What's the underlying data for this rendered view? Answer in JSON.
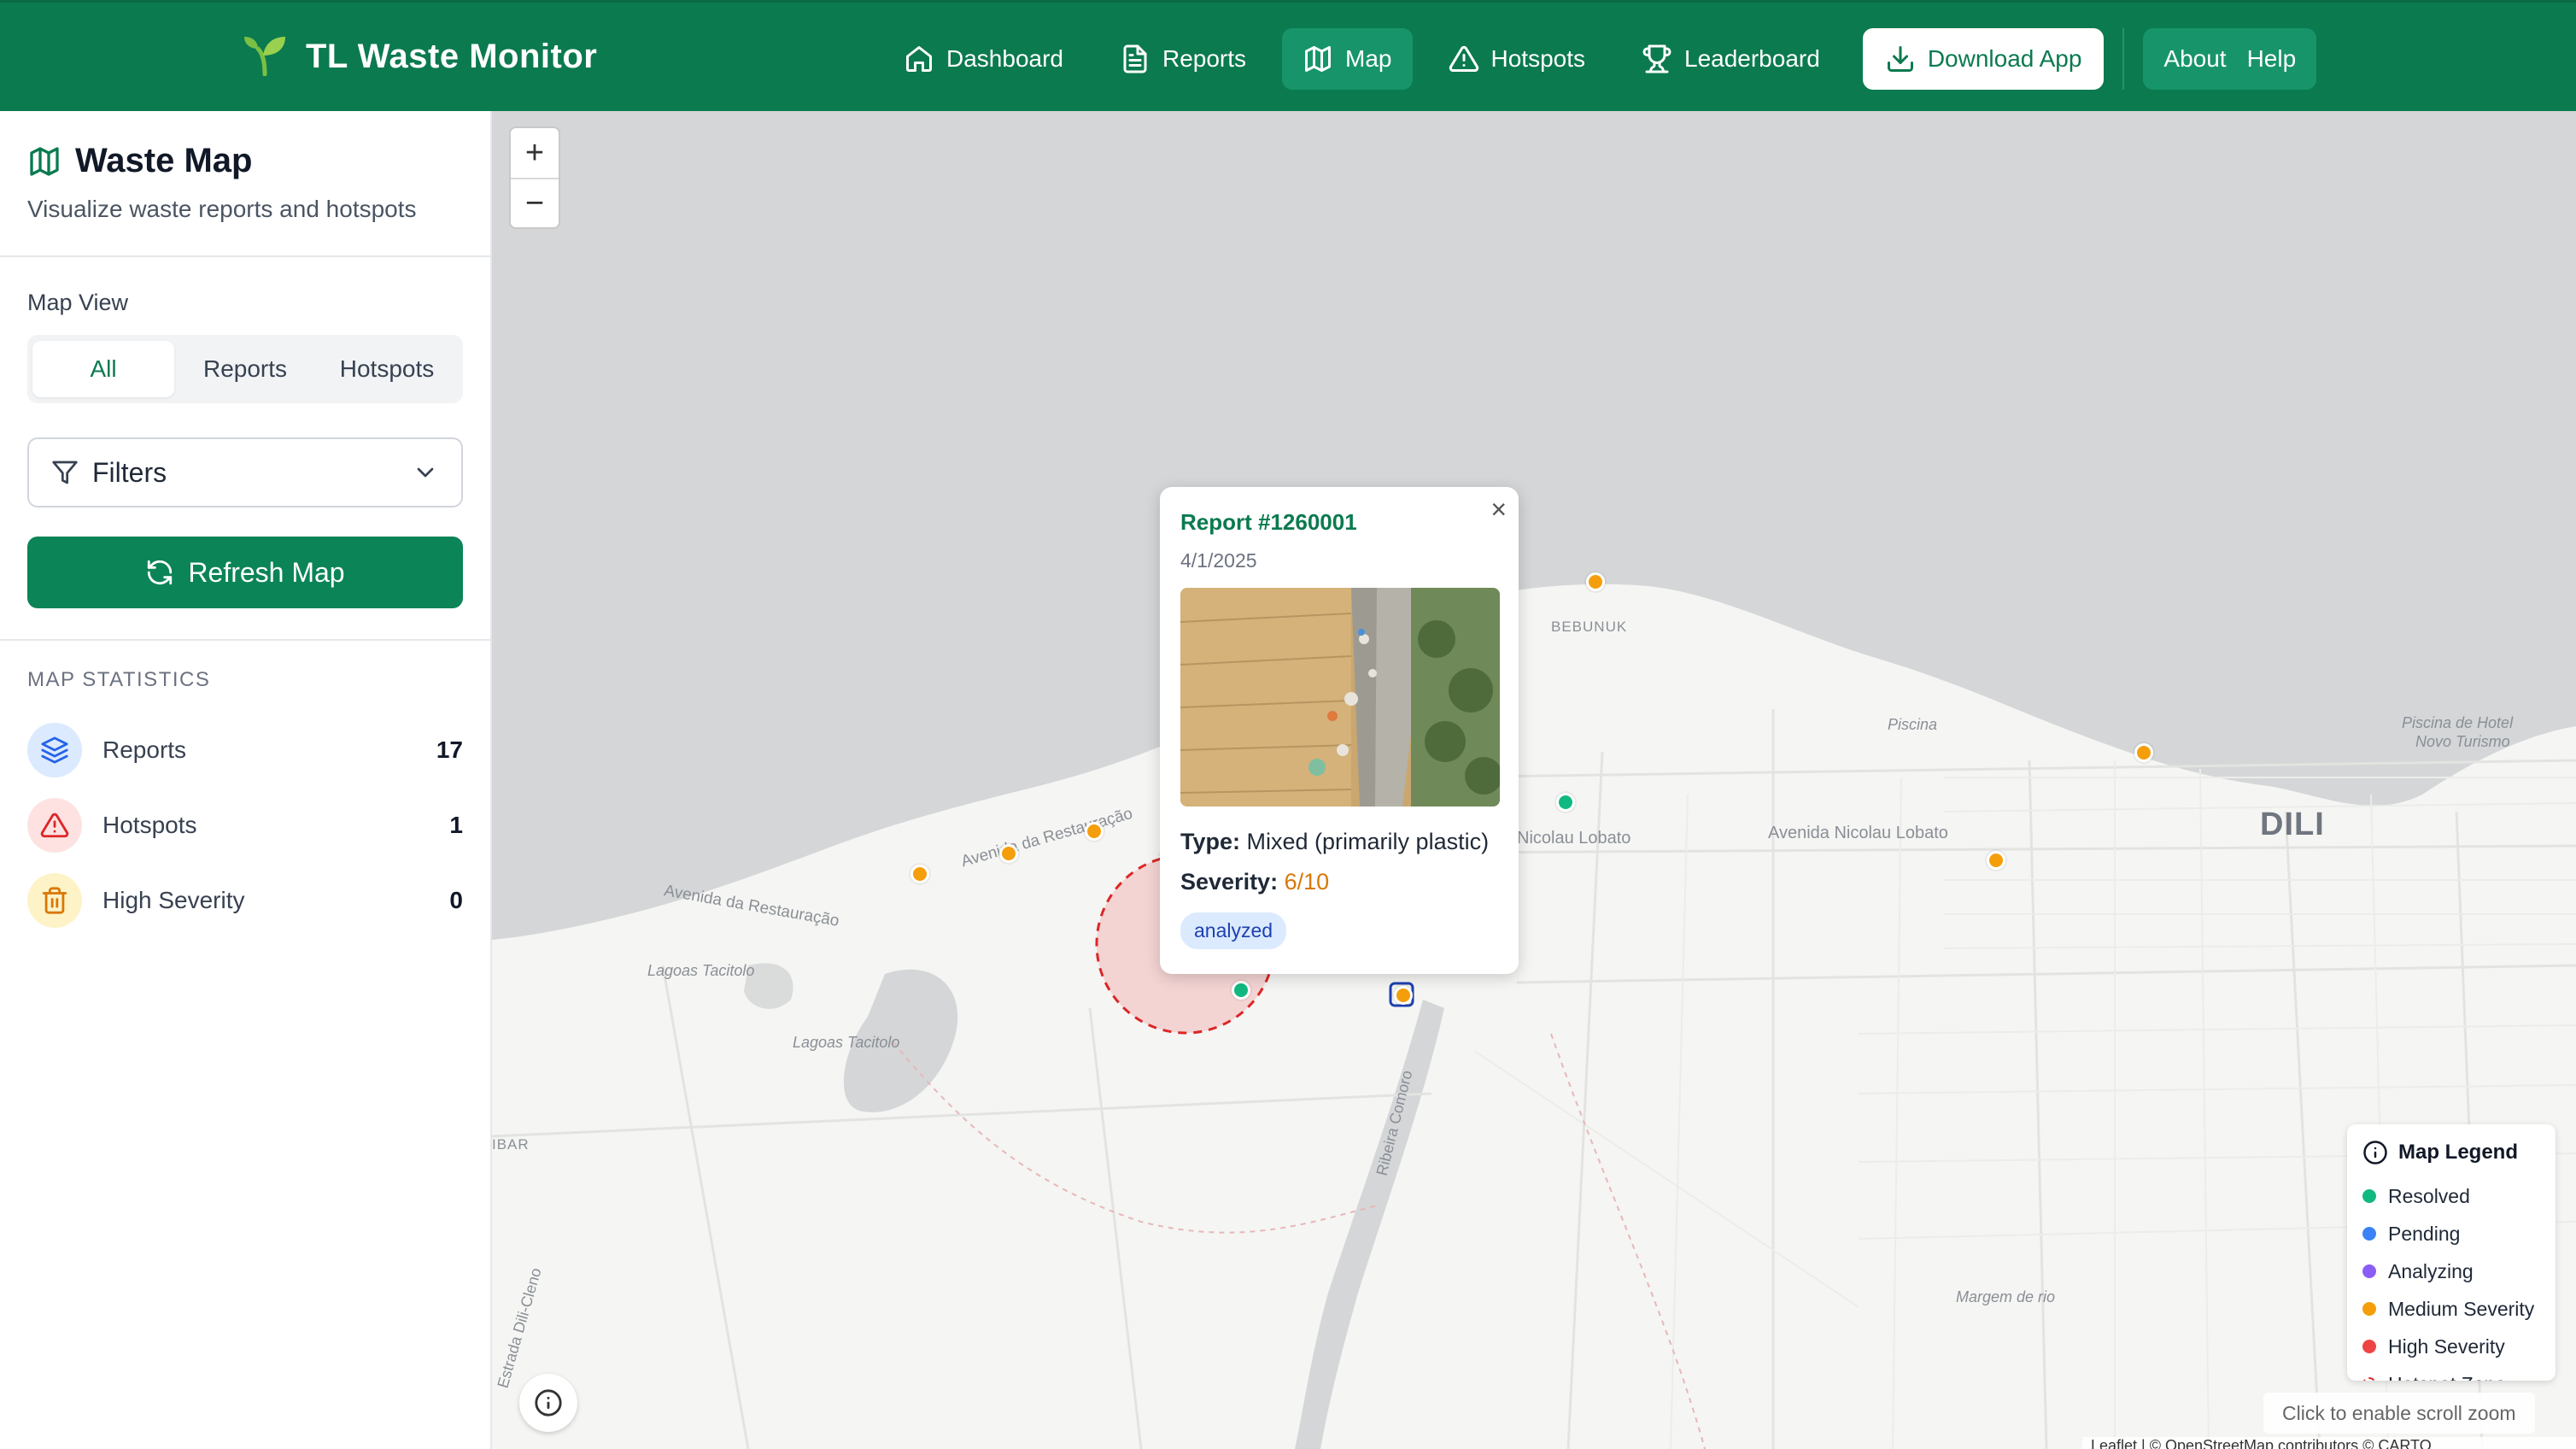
{
  "app": {
    "title": "TL Waste Monitor"
  },
  "nav": {
    "items": [
      {
        "label": "Dashboard"
      },
      {
        "label": "Reports"
      },
      {
        "label": "Map"
      },
      {
        "label": "Hotspots"
      },
      {
        "label": "Leaderboard"
      }
    ],
    "download": "Download App",
    "about": "About",
    "help": "Help"
  },
  "sidebar": {
    "title": "Waste Map",
    "subtitle": "Visualize waste reports and hotspots",
    "map_view_label": "Map View",
    "view_options": [
      "All",
      "Reports",
      "Hotspots"
    ],
    "selected_view": "All",
    "filters_label": "Filters",
    "refresh_label": "Refresh Map",
    "stats_title": "MAP STATISTICS",
    "stats": [
      {
        "label": "Reports",
        "value": "17",
        "icon": "layers-icon",
        "color": "#2563eb"
      },
      {
        "label": "Hotspots",
        "value": "1",
        "icon": "alert-triangle-icon",
        "color": "#dc2626"
      },
      {
        "label": "High Severity",
        "value": "0",
        "icon": "trash-icon",
        "color": "#d97706"
      }
    ]
  },
  "map": {
    "zoom_in": "+",
    "zoom_out": "−",
    "labels": {
      "bebunuk": "BEBUNUK",
      "piscina": "Piscina",
      "piscina_hotel_1": "Piscina de Hotel",
      "piscina_hotel_2": "Novo Turismo",
      "dili": "DILI",
      "avenida_lobato_1": "Nicolau Lobato",
      "avenida_lobato_2": "Avenida Nicolau Lobato",
      "avenida_rest_1": "Avenida da Restauração",
      "avenida_rest_2": "Avenida da Restauração",
      "lagoas_1": "Lagoas Tacitolo",
      "lagoas_2": "Lagoas Tacitolo",
      "ribeira": "Ribeira Comoro",
      "estrada": "Estrada Dili-Cleno",
      "margem": "Margem de rio",
      "ibar": "IBAR"
    },
    "scroll_hint": "Click to enable scroll zoom",
    "attribution": "Leaflet | © OpenStreetMap contributors © CARTO"
  },
  "popup": {
    "title": "Report #1260001",
    "date": "4/1/2025",
    "type_label": "Type:",
    "type_value": "Mixed (primarily plastic)",
    "severity_label": "Severity:",
    "severity_value": "6/10",
    "status": "analyzed",
    "close": "×"
  },
  "legend": {
    "title": "Map Legend",
    "items": [
      {
        "label": "Resolved",
        "color": "#10b981"
      },
      {
        "label": "Pending",
        "color": "#3b82f6"
      },
      {
        "label": "Analyzing",
        "color": "#8b5cf6"
      },
      {
        "label": "Medium Severity",
        "color": "#f59e0b"
      },
      {
        "label": "High Severity",
        "color": "#ef4444"
      },
      {
        "label": "Hotspot Zone",
        "color": "#dc2626"
      }
    ]
  },
  "colors": {
    "brand": "#0b7a4f",
    "accent": "#0b8457",
    "medium_severity": "#f59e0b",
    "resolved": "#10b981"
  }
}
